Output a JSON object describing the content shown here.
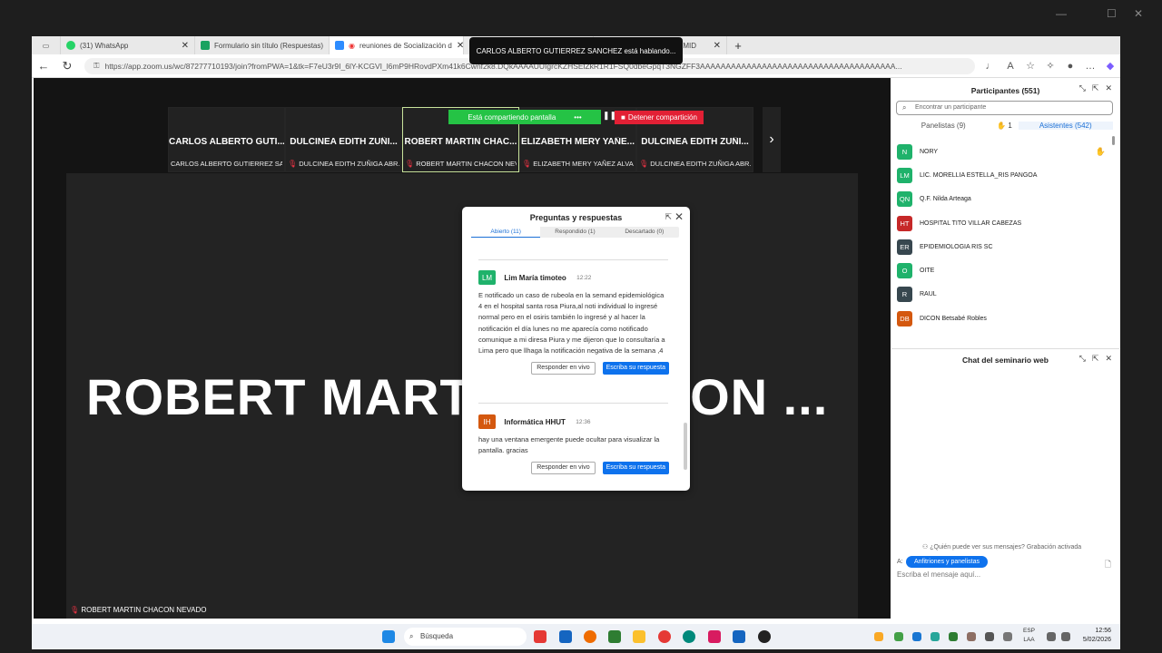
{
  "browser": {
    "tabs": [
      {
        "label": "(31) WhatsApp",
        "active": false
      },
      {
        "label": "Formulario sin título (Respuestas)",
        "active": false
      },
      {
        "label": "reuniones de Socialización d",
        "active": true
      },
      {
        "label": "Acceso y Uso – DIGEMID",
        "active": false
      }
    ],
    "url": "https://app.zoom.us/wc/87277710193/join?fromPWA=1&tk=F7eU3r9I_6lY-KCGVI_l6mP9HRovdPXm41k6Cwnf2k8.DQkAAAAUUIgrcKZHSElZkR1R1FSQ0dbeGpqT3NGZFF3AAAAAAAAAAAAAAAAAAAAAAAAAAAAAAAAAAAAAA..."
  },
  "toast": "CARLOS ALBERTO GUTIERREZ SANCHEZ está hablando...",
  "sharing": {
    "label": "Está compartiendo pantalla",
    "more": "•••",
    "pause": "❚❚",
    "stop": "Detener compartición"
  },
  "strip": [
    {
      "name": "CARLOS ALBERTO GUTI...",
      "sub": "CARLOS ALBERTO GUTIERREZ SAN...",
      "muted": false
    },
    {
      "name": "DULCINEA EDITH ZUÑI...",
      "sub": "DULCINEA EDITH ZUÑIGA ABR...",
      "muted": true
    },
    {
      "name": "ROBERT MARTIN CHAC...",
      "sub": "ROBERT MARTIN CHACON NEV...",
      "muted": true
    },
    {
      "name": "ELIZABETH MERY YAÑE...",
      "sub": "ELIZABETH MERY YAÑEZ ALVAR...",
      "muted": true
    },
    {
      "name": "DULCINEA EDITH ZUÑI...",
      "sub": "DULCINEA EDITH ZUÑIGA ABR...",
      "muted": true
    }
  ],
  "main_video": {
    "big_name": "ROBERT MARTIN CHACON ...",
    "bottom_name": "ROBERT MARTIN CHACON NEVADO"
  },
  "qa": {
    "title": "Preguntas y respuestas",
    "tabs": [
      "Abierto (11)",
      "Respondido (1)",
      "Descartado (0)"
    ],
    "questions": [
      {
        "initials": "LM",
        "color": "#1fb26b",
        "name": "Lim María timoteo",
        "time": "12:22",
        "text": "E notificado un caso de rubeola en la semand epidemiológica 4 en el hospital santa rosa Piura,al noti individual lo ingresé normal pero en el osiris también lo ingresé y al hacer la notificación el día lunes no me aparecía como notificado comunique a mi diresa Piura y me dijeron que lo consultaría a Lima pero que llhaga la notificación negativa de la semana ,4"
      },
      {
        "initials": "IH",
        "color": "#d4580f",
        "name": "Informática HHUT",
        "time": "12:36",
        "text": "hay una ventana emergente puede ocultar para visualizar la pantalla. gracias"
      }
    ],
    "live_label": "Responder en vivo",
    "write_label": "Escriba su respuesta"
  },
  "participants": {
    "title": "Participantes (551)",
    "search_placeholder": "Encontrar un participante",
    "tab_panelists": "Panelistas (9)",
    "hand_count": "1",
    "tab_attendees": "Asistentes (542)",
    "list": [
      {
        "initials": "N",
        "color": "#1fb26b",
        "name": "NORY",
        "hand": true
      },
      {
        "initials": "LM",
        "color": "#1fb26b",
        "name": "LIC. MORELLIA ESTELLA_RIS PANGOA",
        "hand": false
      },
      {
        "initials": "QN",
        "color": "#1fb26b",
        "name": "Q.F. Nilda Arteaga",
        "hand": false
      },
      {
        "initials": "HT",
        "color": "#c62828",
        "name": "HOSPITAL TITO VILLAR CABEZAS",
        "hand": false
      },
      {
        "initials": "ER",
        "color": "#37474f",
        "name": "EPIDEMIOLOGIA RIS SC",
        "hand": false
      },
      {
        "initials": "O",
        "color": "#1fb26b",
        "name": "OITE",
        "hand": false
      },
      {
        "initials": "R",
        "color": "#37474f",
        "name": "RAUL",
        "hand": false
      },
      {
        "initials": "DB",
        "color": "#d4580f",
        "name": "DICON Betsabé Robles",
        "hand": false
      }
    ]
  },
  "chat": {
    "title": "Chat del seminario web",
    "who_can_see": "¿Quién puede ver sus mensajes? Grabación activada",
    "to_label": "A:",
    "to_value": "Anfitriones y panelistas",
    "input_placeholder": "Escriba el mensaje aquí..."
  },
  "taskbar": {
    "search": "Búsqueda",
    "lang": "ESP",
    "lang2": "LAA",
    "time": "12:56",
    "date": "5/02/2026"
  }
}
